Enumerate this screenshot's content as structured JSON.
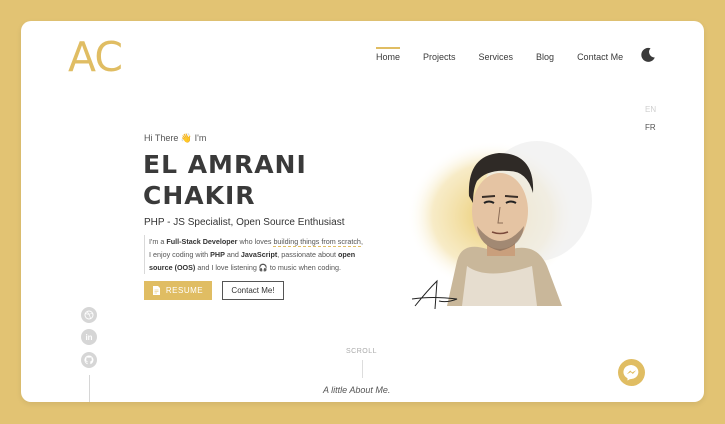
{
  "logo": "AC",
  "nav": {
    "items": [
      {
        "label": "Home"
      },
      {
        "label": "Projects"
      },
      {
        "label": "Services"
      },
      {
        "label": "Blog"
      },
      {
        "label": "Contact Me"
      }
    ],
    "active_index": 0
  },
  "lang": {
    "en": "EN",
    "fr": "FR"
  },
  "hero": {
    "greeting_pre": "Hi There",
    "wave_emoji": "👋",
    "greeting_post": "I'm",
    "name_line1": "EL AMRANI",
    "name_line2": "CHAKIR",
    "role": "PHP - JS Specialist, Open Source Enthusiast",
    "bio": {
      "t1": "I'm a ",
      "b1": "Full-Stack Developer",
      "t2": " who loves ",
      "d1": "building things from scratch",
      "t3": ",",
      "t4": "I enjoy coding with ",
      "b2": "PHP",
      "t5": " and ",
      "b3": "JavaScript",
      "t6": ", passionate about ",
      "b4": "open",
      "b5": "source (OOS)",
      "t7": " and I love listening ",
      "emoji": "🎧",
      "t8": " to music when coding."
    },
    "resume_label": "RESUME",
    "contact_label": "Contact Me!"
  },
  "social_icons": [
    "dribbble-icon",
    "linkedin-icon",
    "github-icon"
  ],
  "scroll_label": "SCROLL",
  "about_heading": "A little About Me.",
  "colors": {
    "accent": "#e0bd63",
    "background": "#e2c373",
    "text": "#3a3a3a"
  }
}
